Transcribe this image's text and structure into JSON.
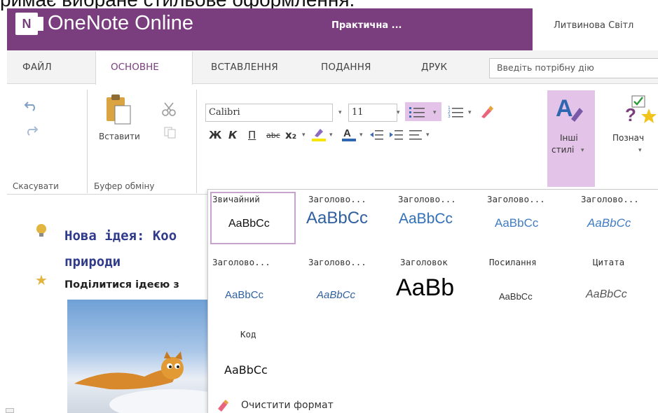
{
  "caption": "римає вибране стильове оформлення.",
  "app": {
    "logo_letter": "N",
    "title": "OneNote Online",
    "notebook": "Практична ...",
    "user": "Литвинова Світл"
  },
  "tabs": [
    {
      "label": "ФАЙЛ",
      "active": false
    },
    {
      "label": "ОСНОВНЕ",
      "active": true
    },
    {
      "label": "ВСТАВЛЕННЯ",
      "active": false
    },
    {
      "label": "ПОДАННЯ",
      "active": false
    },
    {
      "label": "ДРУК",
      "active": false
    }
  ],
  "search": {
    "placeholder": "Введіть потрібну дію"
  },
  "ribbon": {
    "undo_group": "Скасувати",
    "clipboard_group": "Буфер обміну",
    "paste_label": "Вставити",
    "font_name": "Calibri",
    "font_size": "11",
    "bold": "Ж",
    "italic": "К",
    "underline": "П",
    "strike": "abc",
    "subscript": "x₂",
    "styles_label_1": "Інші",
    "styles_label_2": "стилі",
    "tags_label": "Познач"
  },
  "styles": {
    "selected": "Звичайний",
    "items": [
      {
        "name": "Звичайний",
        "sample": "AaBbCc"
      },
      {
        "name": "Заголово...",
        "sample": "AaBbCc"
      },
      {
        "name": "Заголово...",
        "sample": "AaBbCc"
      },
      {
        "name": "Заголово...",
        "sample": "AaBbCc"
      },
      {
        "name": "Заголово...",
        "sample": "AaBbCc"
      },
      {
        "name": "Заголово...",
        "sample": "AaBbCc"
      },
      {
        "name": "Заголово...",
        "sample": "AaBbCc"
      },
      {
        "name": "Заголовок",
        "sample": "AaBb"
      },
      {
        "name": "Посилання",
        "sample": "AaBbCc"
      },
      {
        "name": "Цитата",
        "sample": "AaBbCc"
      },
      {
        "name": "Код",
        "sample": "AaBbCc"
      }
    ],
    "clear_format": "Очистити формат"
  },
  "page": {
    "title_line1": "Нова ідея: Коо",
    "title_line2": "природи",
    "share_text": "Поділитися ідеєю з"
  },
  "colors": {
    "accent": "#7a3e7f",
    "heading_blue": "#2f5f9e",
    "idea_title": "#2f3a8a"
  }
}
